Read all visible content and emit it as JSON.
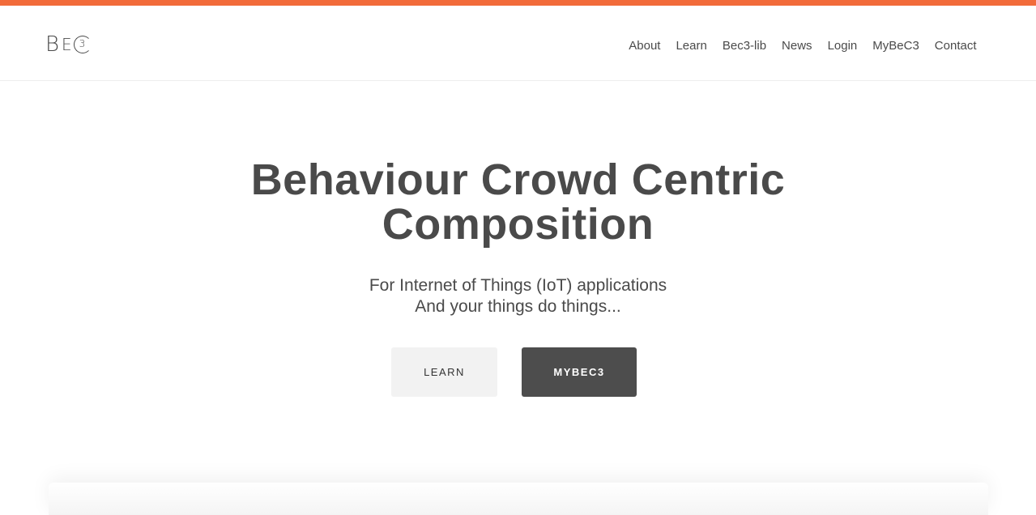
{
  "brand": {
    "logo_letters": {
      "b": "B",
      "e": "E",
      "three": "3"
    },
    "accent_color": "#f26b3a"
  },
  "nav": {
    "items": [
      "About",
      "Learn",
      "Bec3-lib",
      "News",
      "Login",
      "MyBeC3",
      "Contact"
    ]
  },
  "hero": {
    "title_line1": "Behaviour Crowd Centric",
    "title_line2": "Composition",
    "subtitle_line1": "For Internet of Things (IoT) applications",
    "subtitle_line2": "And your things do things..."
  },
  "buttons": {
    "learn_label": "LEARN",
    "mybec3_label": "MYBEC3"
  }
}
